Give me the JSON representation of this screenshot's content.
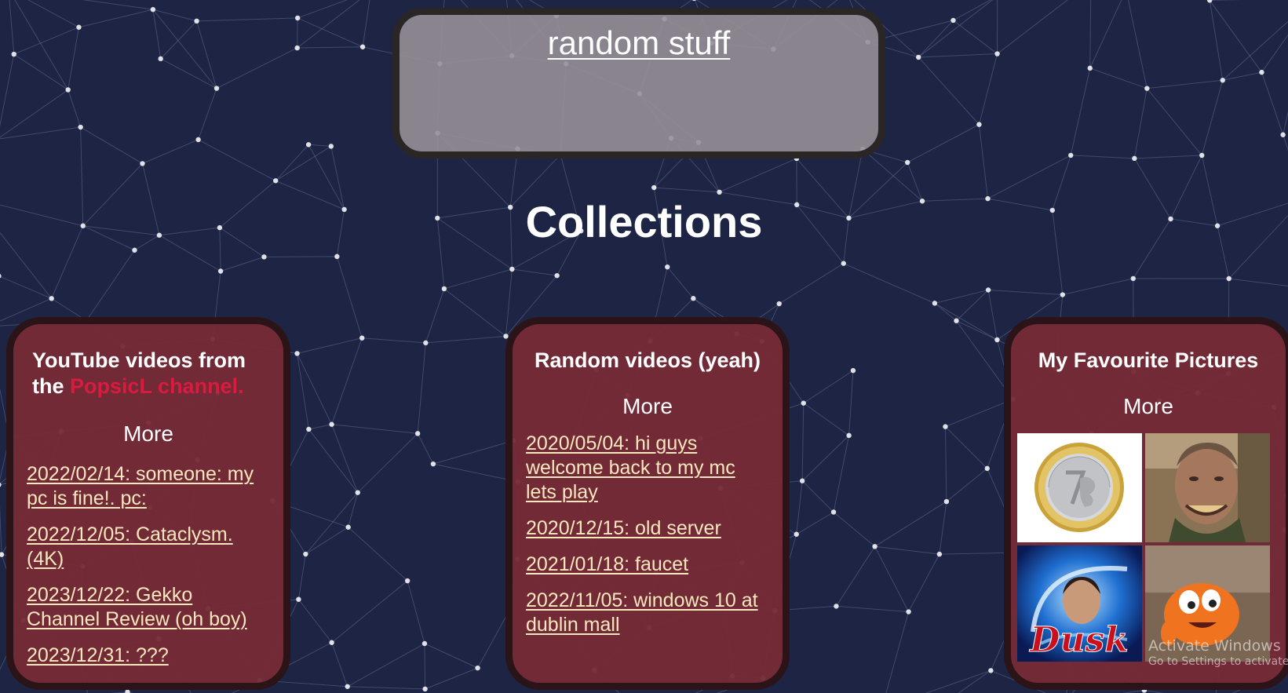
{
  "header": {
    "site_title": "random stuff"
  },
  "main": {
    "heading": "Collections"
  },
  "colors": {
    "background": "#1e2443",
    "card_background": "#762b37",
    "card_border": "#2a1418",
    "header_background": "#968f98",
    "link": "#fbe7bd",
    "highlight": "#d81b3e"
  },
  "cards": [
    {
      "title_prefix": "YouTube videos from the ",
      "title_highlight": "PopsicL channel.",
      "more_label": "More",
      "entries": [
        "2022/02/14: someone: my pc is fine!. pc:",
        "2022/12/05: Cataclysm. (4K)",
        "2023/12/22: Gekko Channel Review (oh boy)",
        "2023/12/31: ???"
      ]
    },
    {
      "title": "Random videos (yeah)",
      "more_label": "More",
      "entries": [
        "2020/05/04: hi guys welcome back to my mc lets play",
        "2020/12/15: old server",
        "2021/01/18: faucet",
        "2022/11/05: windows 10 at dublin mall"
      ]
    },
    {
      "title": "My Favourite Pictures",
      "more_label": "More",
      "pictures": [
        "coin-picture",
        "man-portrait-picture",
        "dusk-portrait-picture",
        "orange-cartoon-picture"
      ],
      "dusk_caption": "Dusk"
    }
  ],
  "os_watermark": {
    "title": "Activate Windows",
    "subtitle": "Go to Settings to activate Windows."
  }
}
